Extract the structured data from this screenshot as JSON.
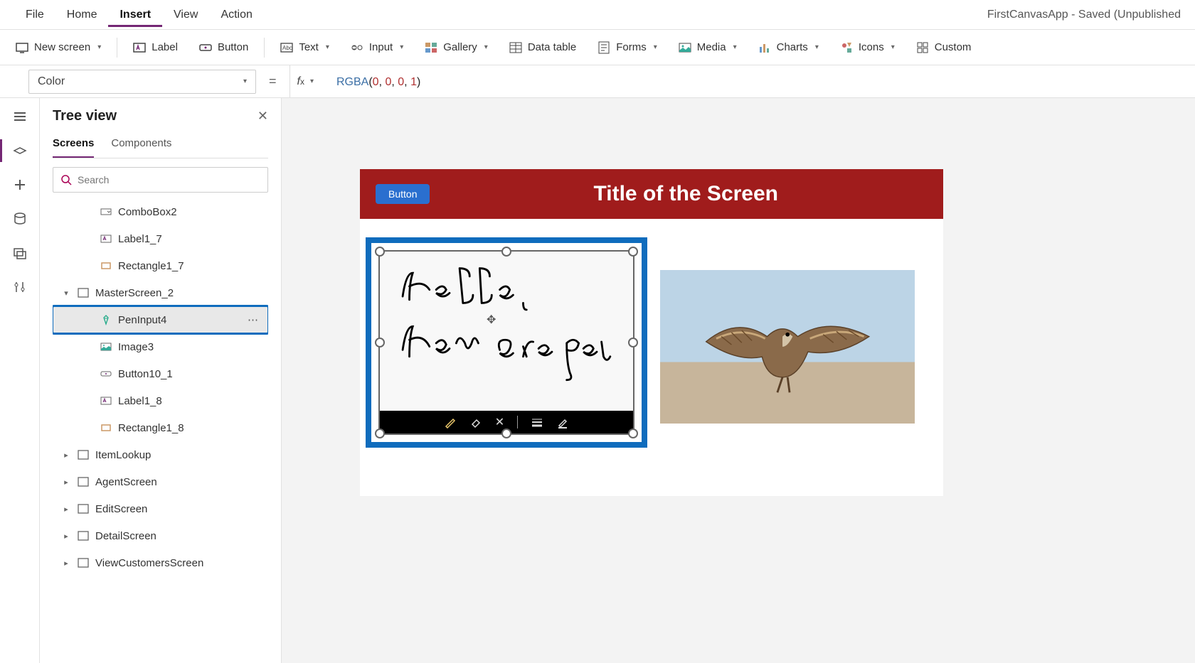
{
  "menu": {
    "tabs": [
      "File",
      "Home",
      "Insert",
      "View",
      "Action"
    ],
    "active": "Insert"
  },
  "appTitle": "FirstCanvasApp - Saved (Unpublished",
  "ribbon": {
    "newScreen": "New screen",
    "label": "Label",
    "button": "Button",
    "text": "Text",
    "input": "Input",
    "gallery": "Gallery",
    "dataTable": "Data table",
    "forms": "Forms",
    "media": "Media",
    "charts": "Charts",
    "icons": "Icons",
    "custom": "Custom"
  },
  "formula": {
    "property": "Color",
    "fn": "RGBA",
    "args": [
      "0",
      "0",
      "0",
      "1"
    ]
  },
  "treePanel": {
    "title": "Tree view",
    "tabs": {
      "screens": "Screens",
      "components": "Components"
    },
    "searchPlaceholder": "Search",
    "items": [
      {
        "name": "ComboBox2",
        "icon": "combobox",
        "indent": 2
      },
      {
        "name": "Label1_7",
        "icon": "label",
        "indent": 2
      },
      {
        "name": "Rectangle1_7",
        "icon": "rectangle",
        "indent": 2
      },
      {
        "name": "MasterScreen_2",
        "icon": "screen",
        "indent": 0,
        "caret": "down"
      },
      {
        "name": "PenInput4",
        "icon": "pen",
        "indent": 2,
        "selected": true,
        "ellipsis": true
      },
      {
        "name": "Image3",
        "icon": "image",
        "indent": 2
      },
      {
        "name": "Button10_1",
        "icon": "button",
        "indent": 2
      },
      {
        "name": "Label1_8",
        "icon": "label",
        "indent": 2
      },
      {
        "name": "Rectangle1_8",
        "icon": "rectangle",
        "indent": 2
      },
      {
        "name": "ItemLookup",
        "icon": "screen",
        "indent": 0,
        "caret": "right"
      },
      {
        "name": "AgentScreen",
        "icon": "screen",
        "indent": 0,
        "caret": "right"
      },
      {
        "name": "EditScreen",
        "icon": "screen",
        "indent": 0,
        "caret": "right"
      },
      {
        "name": "DetailScreen",
        "icon": "screen",
        "indent": 0,
        "caret": "right"
      },
      {
        "name": "ViewCustomersScreen",
        "icon": "screen",
        "indent": 0,
        "caret": "right"
      }
    ]
  },
  "canvas": {
    "headerButton": "Button",
    "headerTitle": "Title of the Screen",
    "handwriting": "Hello,\nHow are you"
  }
}
